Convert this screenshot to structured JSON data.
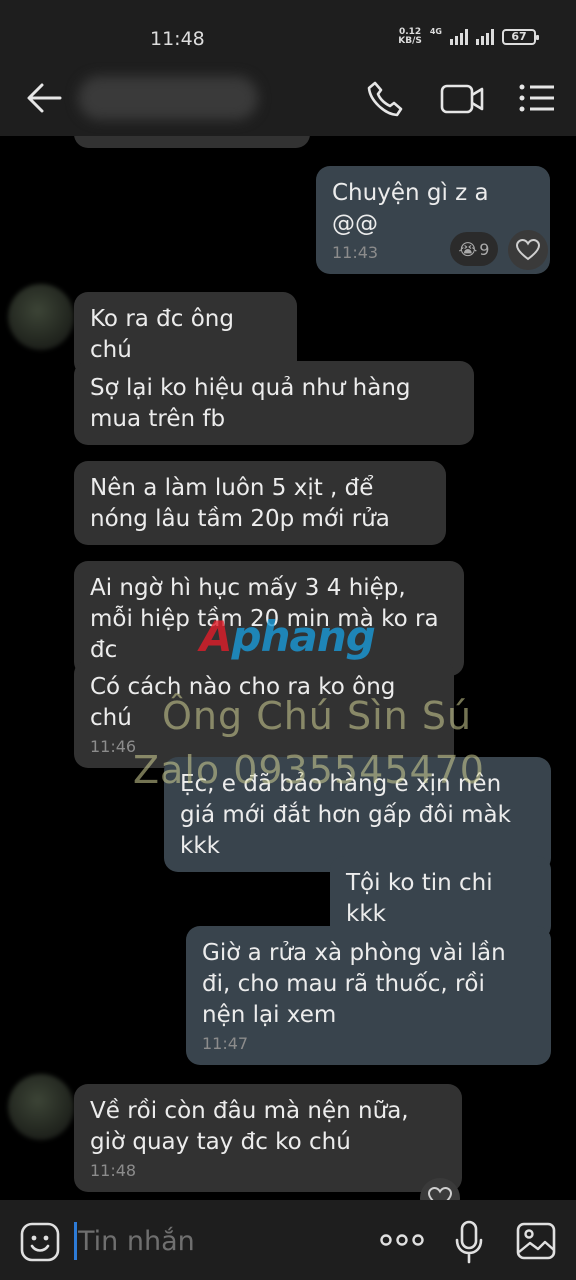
{
  "status_bar": {
    "time": "11:48",
    "net_speed_value": "0.12",
    "net_speed_unit": "KB/S",
    "network_type": "4G",
    "battery": "67"
  },
  "header": {
    "contact_name": ""
  },
  "messages": [
    {
      "side": "out",
      "text": "Chuyện gì z a @@",
      "time": "11:43"
    },
    {
      "side": "in",
      "text": "Ko ra đc ông chú",
      "time": ""
    },
    {
      "side": "in",
      "text": "Sợ lại ko hiệu quả như hàng mua trên fb",
      "time": ""
    },
    {
      "side": "in",
      "text": "Nên a làm luôn 5 xịt , để nóng lâu tầm 20p mới rửa",
      "time": ""
    },
    {
      "side": "in",
      "text": "Ai ngờ hì hục mấy 3 4 hiệp, mỗi hiệp tầm 20 min mà ko ra đc",
      "time": ""
    },
    {
      "side": "in",
      "text": "Có cách nào cho ra ko ông chú",
      "time": "11:46"
    },
    {
      "side": "out",
      "text": "Ẹc, e đã bảo hàng e xịn nên giá mới đắt hơn gấp đôi màk kkk",
      "time": ""
    },
    {
      "side": "out",
      "text": "Tội ko tin chi kkk",
      "time": ""
    },
    {
      "side": "out",
      "text": "Giờ a rửa xà phòng vài lần đi, cho mau rã thuốc, rồi nện lại xem",
      "time": "11:47"
    },
    {
      "side": "in",
      "text": "Về rồi còn đâu mà nện nữa, giờ quay tay đc ko chú",
      "time": "11:48"
    }
  ],
  "reaction": {
    "emoji": "😭",
    "count": "9"
  },
  "watermark": {
    "logo_red": "A",
    "logo_blue": "phang",
    "line1": "Ông Chú Sìn Sú",
    "line2": "Zalo 0935545470"
  },
  "composer": {
    "placeholder": "Tin nhắn"
  }
}
